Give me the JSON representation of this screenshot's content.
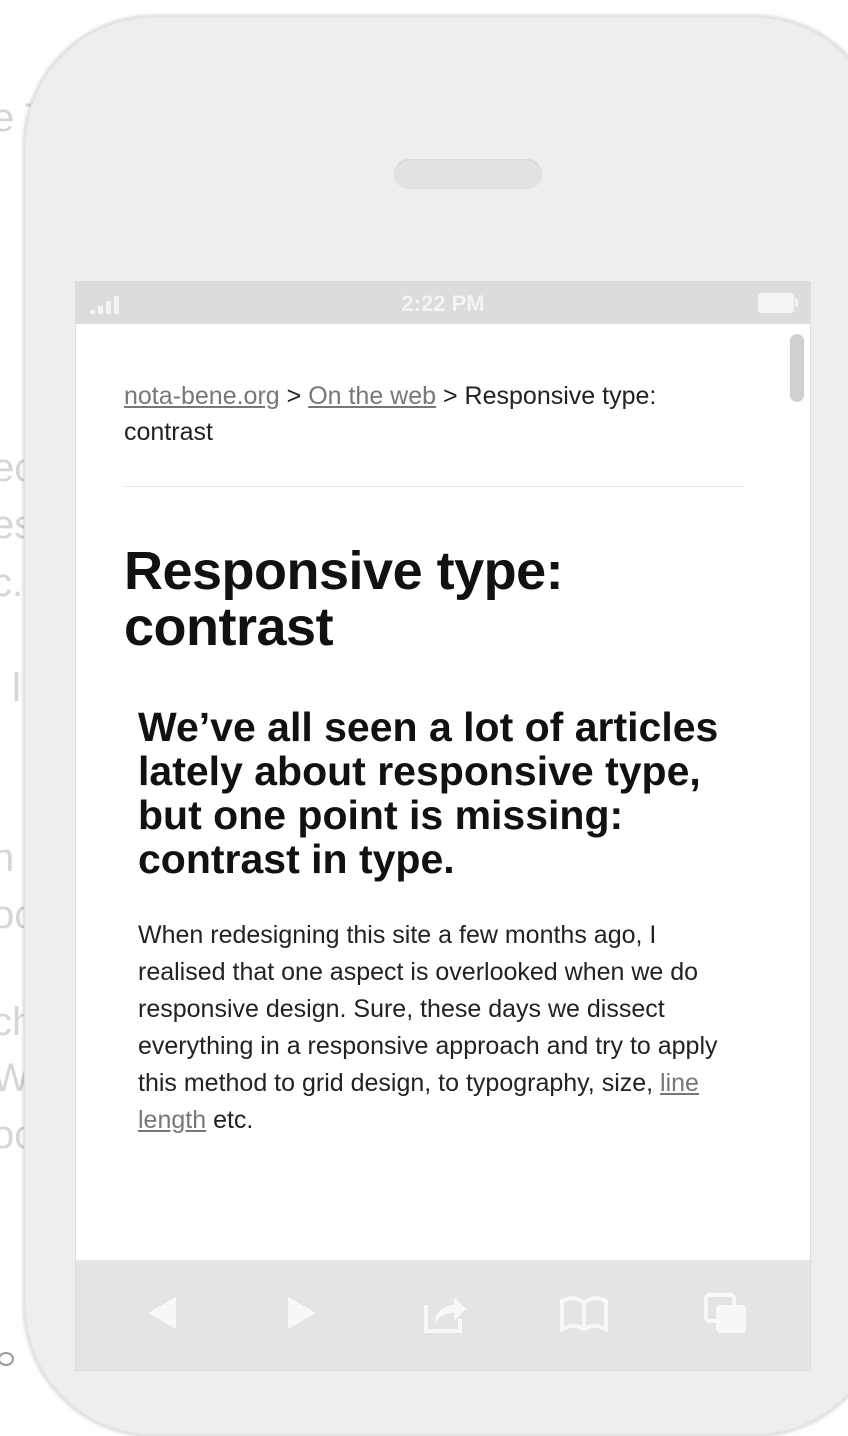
{
  "background_fragments": [
    "e T",
    "ec",
    "es",
    "c.",
    "l",
    "n",
    "oc",
    "ch",
    "W",
    "oc"
  ],
  "status_bar": {
    "time": "2:22 PM",
    "signal_icon": "signal-bars-icon",
    "battery_icon": "battery-icon"
  },
  "breadcrumb": {
    "site": "nota-bene.org",
    "separator1": " > ",
    "section": "On the web",
    "separator2": " > ",
    "current": "Responsive type: contrast"
  },
  "article": {
    "title": "Responsive type: contrast",
    "lead": "We’ve all seen a lot of articles lately about responsive type, but one point is missing: contrast in type.",
    "body_before_link": "When redesigning this site a few months ago, I realised that one aspect is overlooked when we do responsive design. Sure, these days we dissect everything in a responsive approach and try to apply this method to grid design, to typography, size, ",
    "body_link": "line length",
    "body_after_link": " etc."
  },
  "toolbar": {
    "icons": [
      "back-arrow-icon",
      "forward-arrow-icon",
      "share-icon",
      "bookmarks-book-icon",
      "tabs-pages-icon"
    ]
  },
  "colors": {
    "link": "#777777",
    "text": "#111111",
    "phone_body": "#eeeeee",
    "toolbar_icon": "#f8f8f8"
  }
}
